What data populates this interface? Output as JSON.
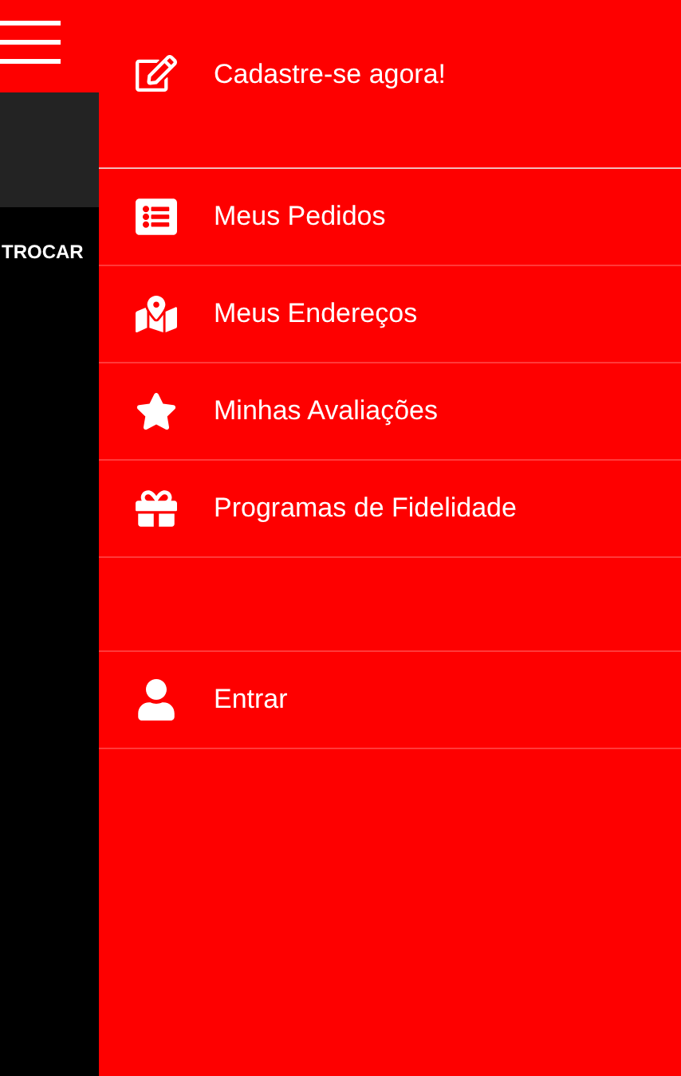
{
  "background_screen": {
    "action_label": "TROCAR"
  },
  "drawer": {
    "header_item": {
      "label": "Cadastre-se agora!"
    },
    "items": [
      {
        "label": "Meus Pedidos"
      },
      {
        "label": "Meus Endereços"
      },
      {
        "label": "Minhas Avaliações"
      },
      {
        "label": "Programas de Fidelidade"
      }
    ],
    "footer_items": [
      {
        "label": "Entrar"
      }
    ]
  }
}
